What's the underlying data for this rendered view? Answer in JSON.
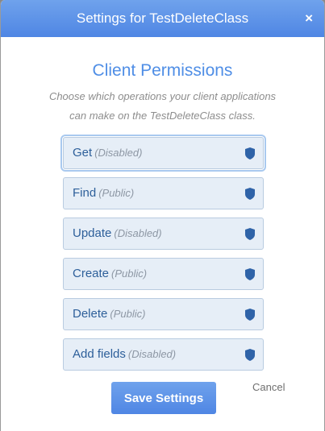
{
  "dialog": {
    "title": "Settings for TestDeleteClass",
    "close_label": "×"
  },
  "content": {
    "heading": "Client Permissions",
    "subtitle_line1": "Choose which operations your client applications",
    "subtitle_line2": "can make on the TestDeleteClass class."
  },
  "permissions": [
    {
      "label": "Get",
      "status": "(Disabled)",
      "icon": "shield-icon"
    },
    {
      "label": "Find",
      "status": "(Public)",
      "icon": "shield-icon"
    },
    {
      "label": "Update",
      "status": "(Disabled)",
      "icon": "shield-icon"
    },
    {
      "label": "Create",
      "status": "(Public)",
      "icon": "shield-icon"
    },
    {
      "label": "Delete",
      "status": "(Public)",
      "icon": "shield-icon"
    },
    {
      "label": "Add fields",
      "status": "(Disabled)",
      "icon": "shield-icon"
    }
  ],
  "footer": {
    "save_label": "Save Settings",
    "cancel_label": "Cancel"
  },
  "colors": {
    "accent": "#4f8ee6",
    "header": "#5a8fe8",
    "shield": "#2f63a8"
  }
}
